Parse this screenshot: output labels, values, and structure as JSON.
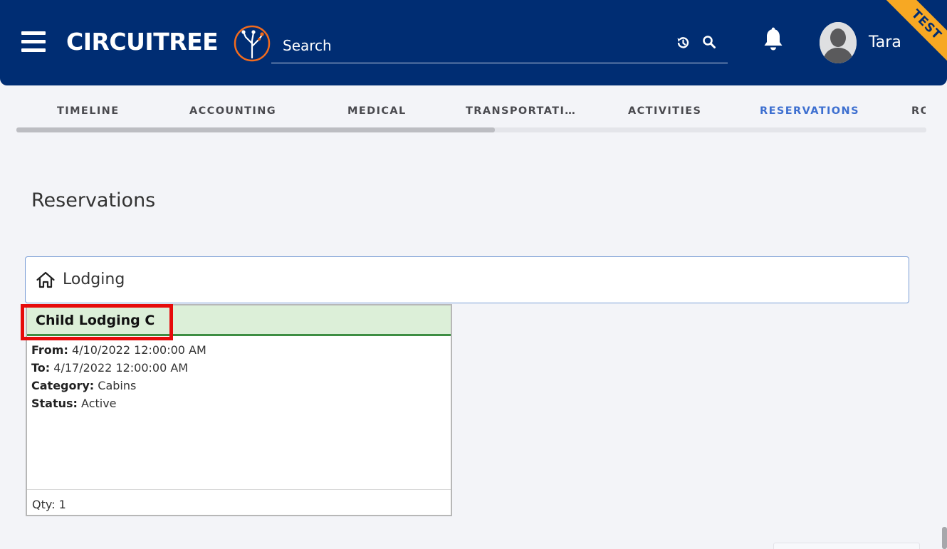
{
  "header": {
    "logo_text": "CIRCUITREE",
    "search_placeholder": "Search",
    "user_name": "Tara",
    "environment_badge": "TEST",
    "brand_color": "#002d73",
    "accent_color": "#f26b1d"
  },
  "tabs": [
    {
      "label": "TIMELINE",
      "active": false
    },
    {
      "label": "ACCOUNTING",
      "active": false
    },
    {
      "label": "MEDICAL",
      "active": false
    },
    {
      "label": "TRANSPORTATI…",
      "active": false
    },
    {
      "label": "ACTIVITIES",
      "active": false
    },
    {
      "label": "RESERVATIONS",
      "active": true
    },
    {
      "label": "RO",
      "active": false
    }
  ],
  "page": {
    "title": "Reservations",
    "section_label": "Lodging",
    "section_icon": "home-icon"
  },
  "card": {
    "title": "Child Lodging C",
    "fields": [
      {
        "label": "From:",
        "value": "4/10/2022 12:00:00 AM"
      },
      {
        "label": "To:",
        "value": "4/17/2022 12:00:00 AM"
      },
      {
        "label": "Category:",
        "value": "Cabins"
      },
      {
        "label": "Status:",
        "value": "Active"
      }
    ],
    "qty_text": "Qty: 1"
  }
}
